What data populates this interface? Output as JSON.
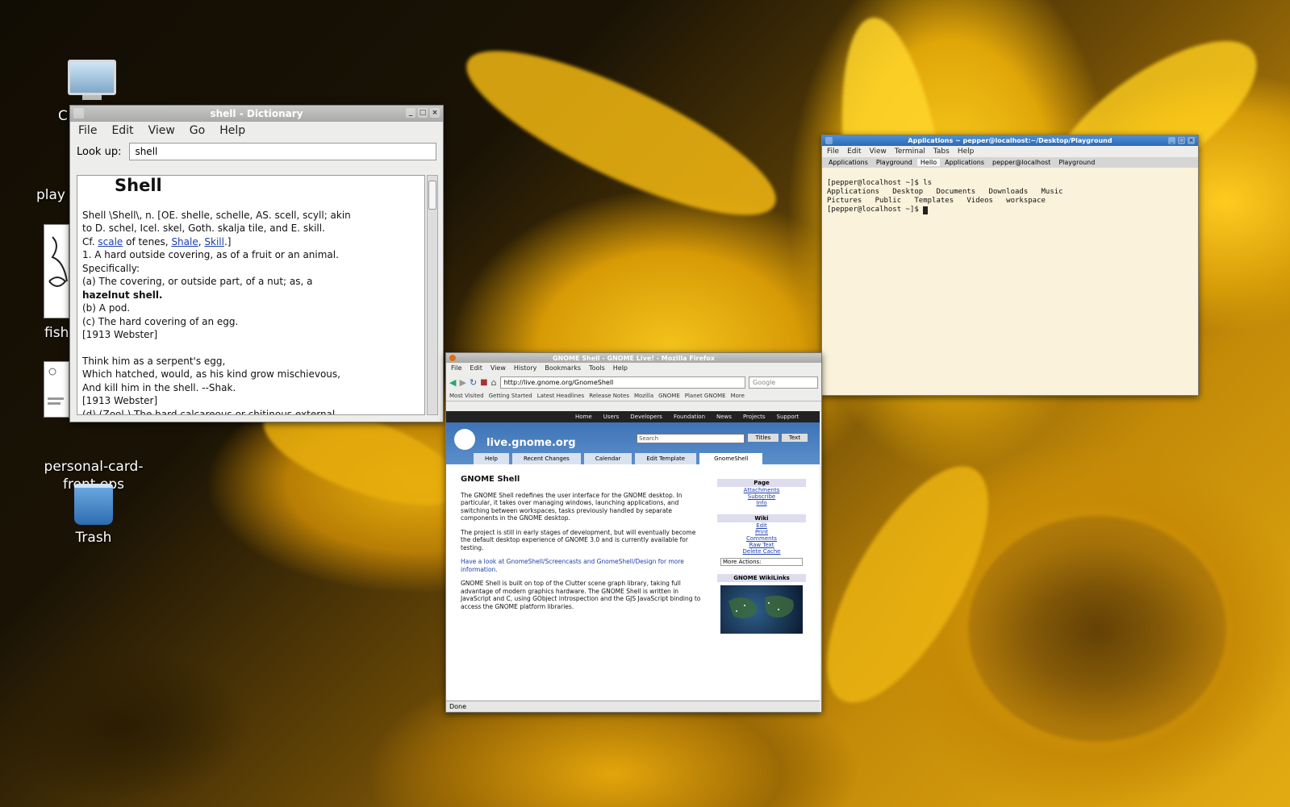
{
  "desktop": {
    "icons": [
      {
        "label": "C",
        "icon": "computer-icon"
      },
      {
        "label": "play",
        "icon": "thumbnail"
      },
      {
        "label": "fish",
        "icon": "thumbnail"
      },
      {
        "label": "personal-card-\nfront.eps",
        "icon": "document-icon"
      },
      {
        "label": "Trash",
        "icon": "trash-icon"
      }
    ]
  },
  "dictionary": {
    "title": "shell - Dictionary",
    "menu": [
      "File",
      "Edit",
      "View",
      "Go",
      "Help"
    ],
    "lookup_label": "Look up:",
    "lookup_value": "shell",
    "heading": "Shell",
    "lines": [
      "Shell \\Shell\\, n. [OE. shelle, schelle, AS. scell, scyll; akin",
      "to D. schel, Icel. skel, Goth. skalja tile, and E. skill.",
      "Cf. ",
      "1. A hard outside covering, as of a fruit or an animal.",
      "Specifically:",
      "(a) The covering, or outside part, of a nut; as, a",
      "hazelnut shell.",
      "(b) A pod.",
      "(c) The hard covering of an egg.",
      "[1913 Webster]",
      "",
      "Think him as a serpent's egg,",
      "Which hatched, would, as his kind grow mischievous,",
      "And kill him in the shell. --Shak.",
      "[1913 Webster]",
      "(d) (Zool.) The hard calcareous or chitinous external"
    ],
    "crossrefs": [
      "scale",
      "Shale",
      "Skill"
    ],
    "crossref_tail": " of tenes, ",
    "crossref_end": ".]"
  },
  "terminal": {
    "title": "Applications ~ pepper@localhost:~/Desktop/Playground",
    "menu": [
      "File",
      "Edit",
      "View",
      "Terminal",
      "Tabs",
      "Help"
    ],
    "tabs": [
      "Applications",
      "Playground",
      "Hello",
      "Applications",
      "pepper@localhost",
      "Playground"
    ],
    "lines": [
      "[pepper@localhost ~]$ ls",
      "Applications   Desktop   Documents   Downloads   Music",
      "Pictures   Public   Templates   Videos   workspace",
      "[pepper@localhost ~]$ "
    ]
  },
  "browser": {
    "title": "GNOME Shell - GNOME Live! - Mozilla Firefox",
    "menu": [
      "File",
      "Edit",
      "View",
      "History",
      "Bookmarks",
      "Tools",
      "Help"
    ],
    "url": "http://live.gnome.org/GnomeShell",
    "search_placeholder": "Google",
    "bookmarks": [
      "Most Visited",
      "Getting Started",
      "Latest Headlines",
      "Release Notes",
      "Mozilla",
      "GNOME",
      "Planet GNOME",
      "More"
    ],
    "site_nav": [
      "Home",
      "Users",
      "Developers",
      "Foundation",
      "News",
      "Projects",
      "Support"
    ],
    "site_title": "live.gnome.org",
    "search_value": "Search",
    "search_btn": "Titles",
    "search_btn2": "Text",
    "page_tabs": [
      "Help",
      "Recent Changes",
      "Calendar",
      "Edit Template",
      "GnomeShell"
    ],
    "page_heading": "GNOME Shell",
    "paragraphs": [
      "The GNOME Shell redefines the user interface for the GNOME desktop. In particular, it takes over managing windows, launching applications, and switching between workspaces, tasks previously handled by separate components in the GNOME desktop.",
      "The project is still in early stages of development, but will eventually become the default desktop experience of GNOME 3.0 and is currently available for testing.",
      "Have a look at GnomeShell/Screencasts and GnomeShell/Design for more information.",
      "GNOME Shell is built on top of the Clutter scene graph library, taking full advantage of modern graphics hardware. The GNOME Shell is written in JavaScript and C, using GObject introspection and the GJS JavaScript binding to access the GNOME platform libraries."
    ],
    "sidebar_title": "Page",
    "sidebar_links": [
      "Attachments",
      "Subscribe",
      "Info"
    ],
    "sidebar_title2": "Wiki",
    "sidebar_links2": [
      "Edit",
      "Print",
      "Comments",
      "Raw Text",
      "Delete Cache"
    ],
    "more_actions": "More Actions:",
    "wiki_label": "GNOME WikiLinks",
    "status": "Done"
  }
}
